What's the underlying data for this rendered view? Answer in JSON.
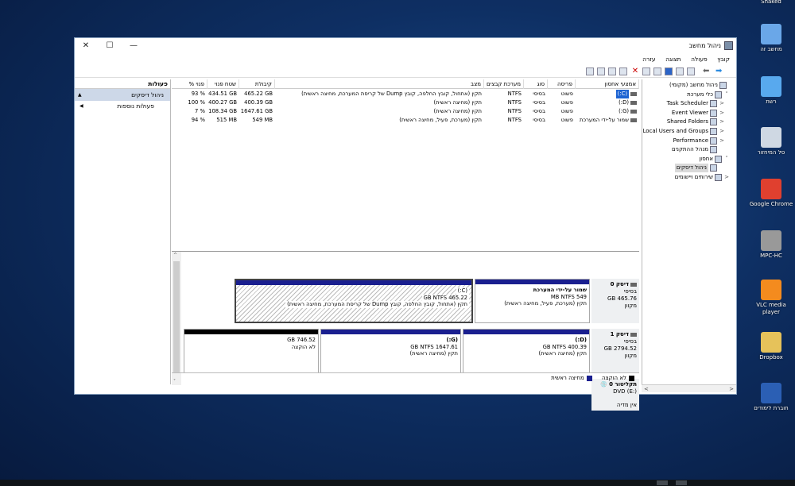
{
  "window": {
    "title": "ניהול מחשב"
  },
  "menu": [
    "קובץ",
    "פעולה",
    "תצוגה",
    "עזרה"
  ],
  "desktop": {
    "icons": [
      {
        "label": "Shaked",
        "color": "#e9e9e9"
      },
      {
        "label": "מחשב זה",
        "color": "#6aa7e8"
      },
      {
        "label": "רשת",
        "color": "#58a9ee"
      },
      {
        "label": "סל המיחזור",
        "color": "#cfd8e3"
      },
      {
        "label": "Google Chrome",
        "color": "#e0402f"
      },
      {
        "label": "MPC-HC",
        "color": "#999999"
      },
      {
        "label": "VLC media player",
        "color": "#f48b1e"
      },
      {
        "label": "Dropbox",
        "color": "#e6c25a"
      },
      {
        "label": "חוברת לימודים",
        "color": "#2b5fb4"
      }
    ]
  },
  "tree": {
    "items": [
      {
        "label": "ניהול מחשב (מקומי)",
        "depth": 0,
        "exp": ""
      },
      {
        "label": "כלי מערכת",
        "depth": 1,
        "exp": "˅"
      },
      {
        "label": "Task Scheduler",
        "depth": 2,
        "exp": "<"
      },
      {
        "label": "Event Viewer",
        "depth": 2,
        "exp": "<"
      },
      {
        "label": "Shared Folders",
        "depth": 2,
        "exp": "<"
      },
      {
        "label": "Local Users and Groups",
        "depth": 2,
        "exp": "<"
      },
      {
        "label": "Performance",
        "depth": 2,
        "exp": "<"
      },
      {
        "label": "מנהל ההתקנים",
        "depth": 2,
        "exp": ""
      },
      {
        "label": "אחסון",
        "depth": 1,
        "exp": "˅"
      },
      {
        "label": "ניהול דיסקים",
        "depth": 2,
        "exp": "",
        "selected": true
      },
      {
        "label": "שירותים ויישומים",
        "depth": 1,
        "exp": "<"
      }
    ]
  },
  "actions": {
    "header": "פעולות",
    "section": "ניהול דיסקים",
    "more": "פעולות נוספות"
  },
  "list": {
    "columns": [
      "אמצעי אחסון",
      "פריסה",
      "סוג",
      "מערכת קבצים",
      "מצב",
      "קיבולת",
      "שטח פנוי",
      "% פנוי"
    ],
    "rows": [
      {
        "volume": "(C:)",
        "selected": true,
        "layout": "פשוט",
        "type": "בסיסי",
        "fs": "NTFS",
        "status": "תקין (אתחול, קובץ החלפה, קובץ Dump של קריסת המערכת, מחיצה ראשית)",
        "capacity": "465.22 GB",
        "free": "434.51 GB",
        "pct": "93 %"
      },
      {
        "volume": "(D:)",
        "selected": false,
        "layout": "פשוט",
        "type": "בסיסי",
        "fs": "NTFS",
        "status": "תקין (מחיצה ראשית)",
        "capacity": "400.39 GB",
        "free": "400.27 GB",
        "pct": "100 %"
      },
      {
        "volume": "(G:)",
        "selected": false,
        "layout": "פשוט",
        "type": "בסיסי",
        "fs": "NTFS",
        "status": "תקין (מחיצה ראשית)",
        "capacity": "1647.61 GB",
        "free": "108.34 GB",
        "pct": "7 %"
      },
      {
        "volume": "שמור על-ידי המערכת",
        "selected": false,
        "layout": "פשוט",
        "type": "בסיסי",
        "fs": "NTFS",
        "status": "תקין (מערכת, פעיל, מחיצה ראשית)",
        "capacity": "549 MB",
        "free": "515 MB",
        "pct": "94 %"
      }
    ]
  },
  "disks": {
    "disk0": {
      "name": "דיסק 0",
      "type": "בסיסי",
      "size": "465.76 GB",
      "state": "מקוון",
      "parts": [
        {
          "title": "שמור על-ידי המערכת",
          "size": "549 MB NTFS",
          "status": "תקין (מערכת, פעיל, מחיצה ראשית)"
        },
        {
          "title": "(C:)",
          "size": "465.22 GB NTFS",
          "status": "תקין (אתחול, קובץ החלפה, קובץ Dump של קריסת המערכת, מחיצה ראשית)"
        }
      ]
    },
    "disk1": {
      "name": "דיסק 1",
      "type": "בסיסי",
      "size": "2794.52 GB",
      "state": "מקוון",
      "parts": [
        {
          "title": "(D:)",
          "size": "400.39 GB NTFS",
          "status": "תקין (מחיצה ראשית)"
        },
        {
          "title": "(G:)",
          "size": "1647.61 GB NTFS",
          "status": "תקין (מחיצה ראשית)"
        },
        {
          "title": "",
          "size": "746.52 GB",
          "status": "לא הוקצה"
        }
      ]
    },
    "cdrom0": {
      "name": "תקליטור 0",
      "type": "DVD (E:)",
      "state": "אין מדיה"
    }
  },
  "legend": {
    "unallocated": "לא הוקצה",
    "primary": "מחיצה ראשית",
    "colors": {
      "unallocated": "#000000",
      "primary": "#1a1f8f"
    }
  }
}
